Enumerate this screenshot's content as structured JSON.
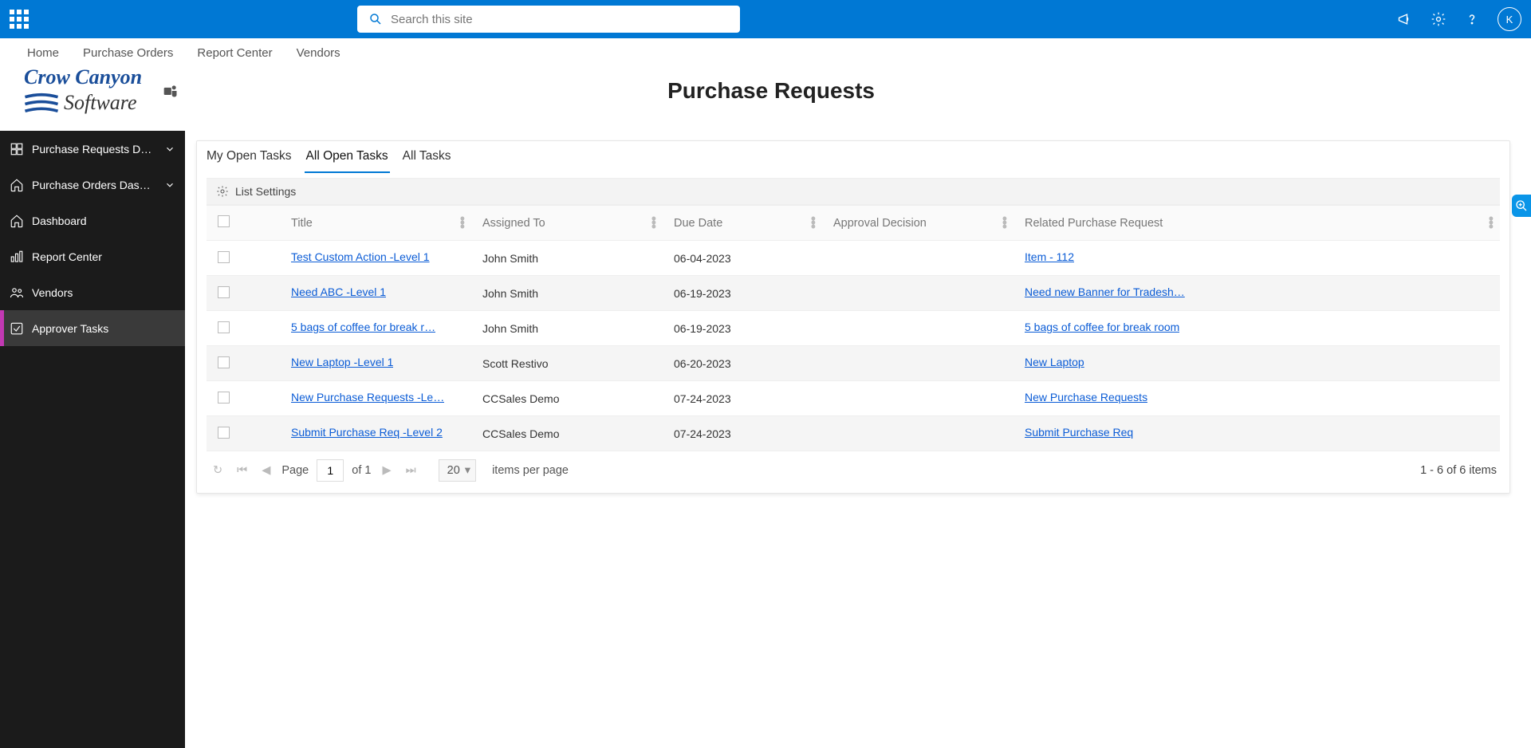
{
  "colors": {
    "brand": "#0078d4",
    "link": "#0b5cd6",
    "accent": "#c239b3"
  },
  "topbar": {
    "search_placeholder": "Search this site",
    "avatar_initial": "K"
  },
  "subnav": [
    "Home",
    "Purchase Orders",
    "Report Center",
    "Vendors"
  ],
  "logo": {
    "line1": "Crow Canyon",
    "line2": "Software"
  },
  "page_title": "Purchase Requests",
  "sidebar": {
    "items": [
      {
        "label": "Purchase Requests Dashb",
        "icon": "grid",
        "chevron": true
      },
      {
        "label": "Purchase Orders Dashbo",
        "icon": "home",
        "chevron": true
      },
      {
        "label": "Dashboard",
        "icon": "home"
      },
      {
        "label": "Report Center",
        "icon": "chart"
      },
      {
        "label": "Vendors",
        "icon": "people"
      },
      {
        "label": "Approver Tasks",
        "icon": "check",
        "active": true
      }
    ]
  },
  "tabs": [
    {
      "label": "My Open Tasks"
    },
    {
      "label": "All Open Tasks",
      "active": true
    },
    {
      "label": "All Tasks"
    }
  ],
  "list_settings_label": "List Settings",
  "columns": [
    "",
    "",
    "Title",
    "Assigned To",
    "Due Date",
    "Approval Decision",
    "Related Purchase Request"
  ],
  "rows": [
    {
      "title": "Test Custom Action -Level 1",
      "assigned": "John Smith",
      "due": "06-04-2023",
      "decision": "",
      "related": "Item - 112"
    },
    {
      "title": "Need ABC -Level 1",
      "assigned": "John Smith",
      "due": "06-19-2023",
      "decision": "",
      "related": "Need new Banner for Tradesh…"
    },
    {
      "title": "5 bags of coffee for break r…",
      "assigned": "John Smith",
      "due": "06-19-2023",
      "decision": "",
      "related": "5 bags of coffee for break room"
    },
    {
      "title": "New Laptop -Level 1",
      "assigned": "Scott Restivo",
      "due": "06-20-2023",
      "decision": "",
      "related": "New Laptop"
    },
    {
      "title": "New Purchase Requests -Le…",
      "assigned": "CCSales Demo",
      "due": "07-24-2023",
      "decision": "",
      "related": "New Purchase Requests"
    },
    {
      "title": "Submit Purchase Req -Level 2",
      "assigned": "CCSales Demo",
      "due": "07-24-2023",
      "decision": "",
      "related": "Submit Purchase Req"
    }
  ],
  "pager": {
    "page_label_prefix": "Page",
    "page_value": "1",
    "page_label_suffix": "of 1",
    "items_per_page_value": "20",
    "items_per_page_label": "items per page",
    "summary": "1 - 6 of 6 items"
  }
}
